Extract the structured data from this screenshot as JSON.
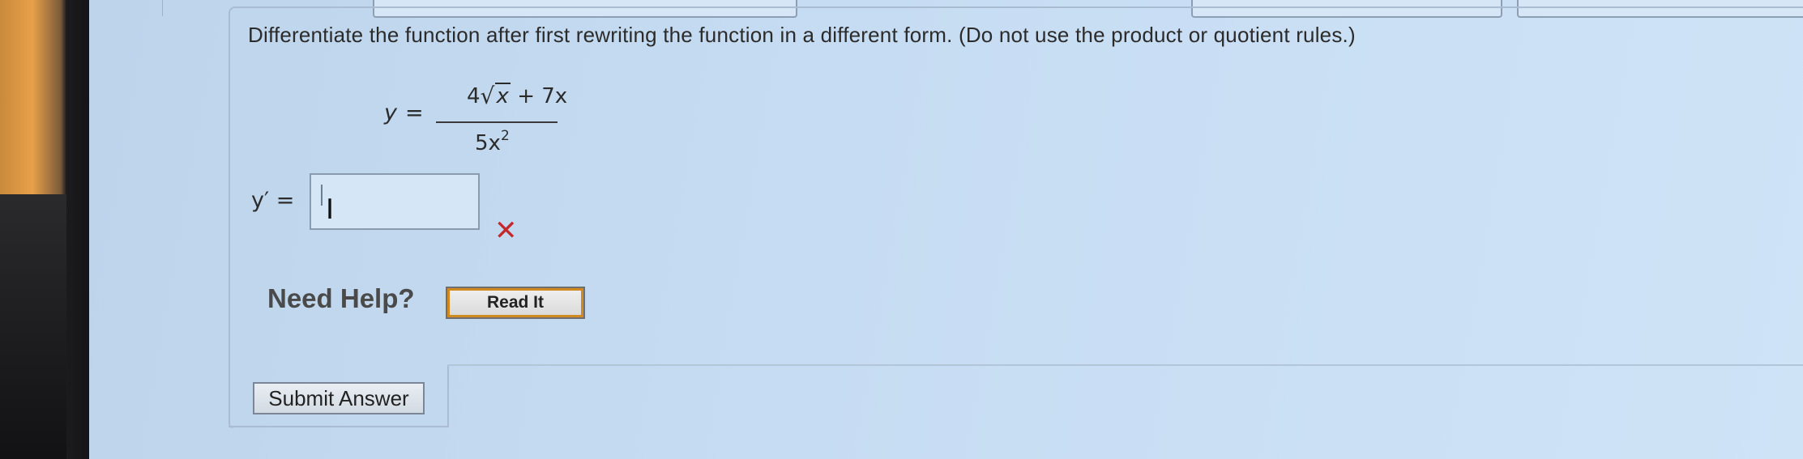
{
  "question": {
    "text": "Differentiate the function after first rewriting the function in a different form. (Do not use the product or quotient rules.)"
  },
  "equation": {
    "lhs": "y",
    "equals": "=",
    "coef": "4",
    "radicand": "x",
    "numerator_rest": " + 7x",
    "denominator_base": "5x",
    "denominator_exp": "2"
  },
  "answer": {
    "label": "y′ =",
    "value": "",
    "status": "incorrect",
    "incorrect_mark": "✕"
  },
  "help": {
    "label": "Need Help?",
    "read_it": "Read It"
  },
  "submit": {
    "label": "Submit Answer"
  },
  "colors": {
    "incorrect": "#c4272c",
    "read_it_border": "#d18a1f"
  },
  "icons": {
    "text_cursor": "text-cursor-icon",
    "incorrect": "incorrect-x-icon"
  }
}
